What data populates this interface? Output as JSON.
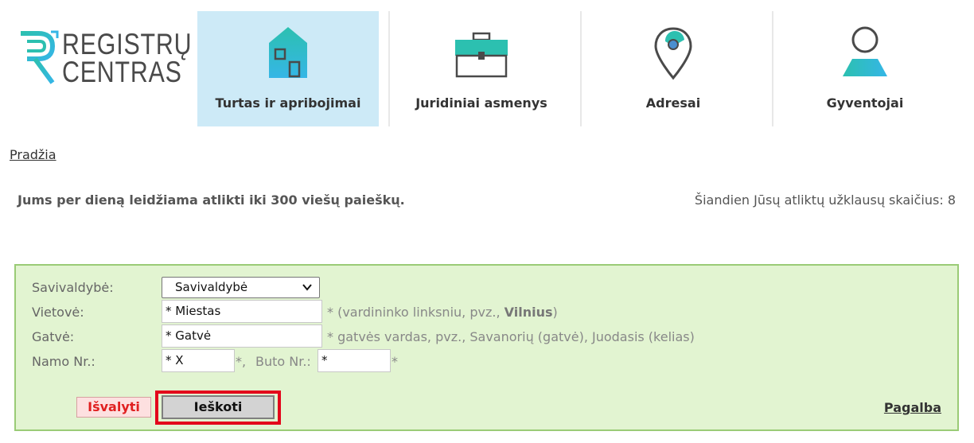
{
  "logo": {
    "line1": "REGISTRŲ",
    "line2": "CENTRAS"
  },
  "nav": {
    "items": [
      {
        "label": "Turtas ir apribojimai",
        "icon": "house-icon",
        "active": true
      },
      {
        "label": "Juridiniai asmenys",
        "icon": "briefcase-icon",
        "active": false
      },
      {
        "label": "Adresai",
        "icon": "map-pin-icon",
        "active": false
      },
      {
        "label": "Gyventojai",
        "icon": "person-icon",
        "active": false
      }
    ]
  },
  "breadcrumb": {
    "home": "Pradžia"
  },
  "info": {
    "limit_text": "Jums per dieną leidžiama atlikti iki 300 viešų paieškų.",
    "count_text": "Šiandien Jūsų atliktų užklausų skaičius: 8"
  },
  "form": {
    "municipality_label": "Savivaldybė:",
    "municipality_value": "Savivaldybė",
    "locality_label": "Vietovė:",
    "locality_value": "* Miestas",
    "locality_hint_pre": "* (vardininko linksniu, pvz.,",
    "locality_hint_example": "Vilnius",
    "locality_hint_post": ")",
    "street_label": "Gatvė:",
    "street_value": "* Gatvė",
    "street_hint": "* gatvės vardas, pvz., Savanorių (gatvė), Juodasis (kelias)",
    "house_label": "Namo Nr.:",
    "house_value": "* X",
    "house_suffix": "*,",
    "flat_label": "Buto Nr.:",
    "flat_value": "*",
    "flat_suffix": "*"
  },
  "buttons": {
    "clear": "Išvalyti",
    "search": "Ieškoti",
    "help": "Pagalba"
  },
  "colors": {
    "accent_teal": "#2cc0b0",
    "active_tab": "#cdeaf7",
    "form_bg": "#e2f4d1",
    "form_border": "#9acb76",
    "highlight": "#e3051b",
    "clear_text": "#e02020"
  }
}
